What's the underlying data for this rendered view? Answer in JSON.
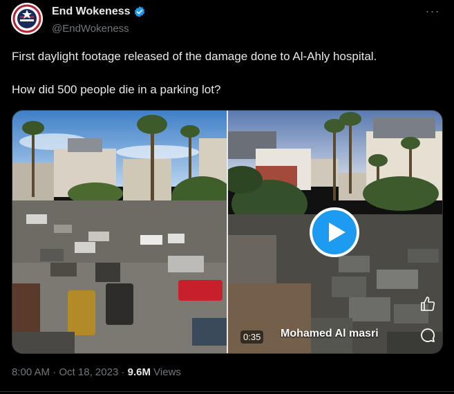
{
  "author": {
    "display_name": "End Wokeness",
    "handle": "@EndWokeness",
    "avatar_icon": "end-wokeness-badge-icon",
    "verified_icon": "verified-badge-icon",
    "verified_color": "#1d9bf0"
  },
  "more_icon_text": "···",
  "tweet": {
    "line1": "First daylight footage released of the damage done to Al-Ahly hospital.",
    "line2": "How did 500 people die in a parking lot?"
  },
  "media": {
    "duration": "0:35",
    "overlay_name": "Mohamed Al masri",
    "play_icon": "play-icon",
    "play_color": "#1d9bf0",
    "like_icon": "thumbs-up-icon",
    "comment_icon": "comment-icon"
  },
  "meta": {
    "time": "8:00 AM",
    "sep1": " · ",
    "date": "Oct 18, 2023",
    "sep2": " · ",
    "views_count": "9.6M",
    "views_label": " Views"
  },
  "colors": {
    "background": "#000000",
    "text": "#e7e9ea",
    "secondary": "#71767b",
    "border": "#2f3336"
  }
}
